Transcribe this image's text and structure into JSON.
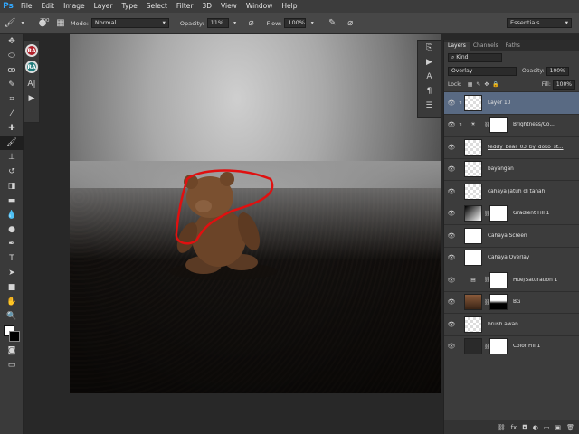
{
  "app": {
    "logo": "Ps"
  },
  "menu": [
    "File",
    "Edit",
    "Image",
    "Layer",
    "Type",
    "Select",
    "Filter",
    "3D",
    "View",
    "Window",
    "Help"
  ],
  "options": {
    "brush_size": "200",
    "mode_label": "Mode:",
    "mode_value": "Normal",
    "opacity_label": "Opacity:",
    "opacity_value": "11%",
    "flow_label": "Flow:",
    "flow_value": "100%",
    "workspace": "Essentials"
  },
  "mini_panel": {
    "buttons": [
      "RA",
      "RA"
    ]
  },
  "layers_panel": {
    "tabs": [
      "Layers",
      "Channels",
      "Paths"
    ],
    "filter_kind": "Kind",
    "blend_mode": "Overlay",
    "opacity_label": "Opacity:",
    "opacity_value": "100%",
    "lock_label": "Lock:",
    "fill_label": "Fill:",
    "fill_value": "100%",
    "layers": [
      {
        "name": "Layer 10",
        "thumb": "checker",
        "selected": true
      },
      {
        "name": "Brightness/Co...",
        "thumb": "adjust",
        "mask": true
      },
      {
        "name": "teddy_bear_03_by_doko_st...",
        "thumb": "checker"
      },
      {
        "name": "bayangan",
        "thumb": "checker"
      },
      {
        "name": "cahaya jatuh di tanah",
        "thumb": "checker"
      },
      {
        "name": "Gradient Fill 1",
        "thumb": "gradient",
        "mask": true
      },
      {
        "name": "Cahaya Screen",
        "thumb": "white"
      },
      {
        "name": "Cahaya Overlay",
        "thumb": "white"
      },
      {
        "name": "Hue/Saturation 1",
        "thumb": "adjust",
        "mask": true
      },
      {
        "name": "BG",
        "thumb": "photo",
        "mask": true
      },
      {
        "name": "brush awan",
        "thumb": "checker"
      },
      {
        "name": "Color Fill 1",
        "thumb": "dark",
        "mask": true
      }
    ],
    "bottom_icons": [
      "link-icon",
      "fx-icon",
      "mask-icon",
      "adjustment-icon",
      "folder-icon",
      "new-layer-icon",
      "trash-icon"
    ]
  },
  "tools": [
    "move",
    "marquee",
    "lasso",
    "quick-select",
    "crop",
    "eyedropper",
    "healing",
    "brush",
    "clone-stamp",
    "history-brush",
    "eraser",
    "gradient",
    "blur",
    "dodge",
    "pen",
    "type",
    "path-select",
    "rectangle",
    "hand",
    "zoom"
  ]
}
